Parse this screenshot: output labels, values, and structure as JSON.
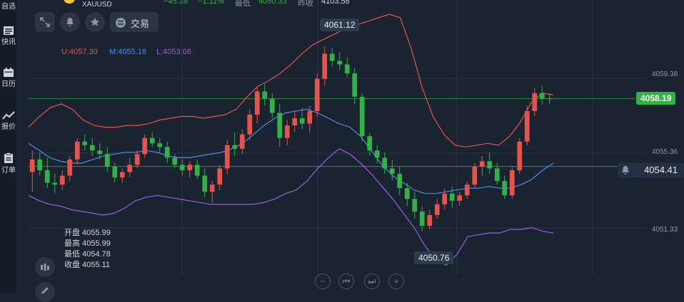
{
  "sidebar": {
    "items": [
      {
        "label": "自选",
        "icon": "star-list-icon"
      },
      {
        "label": "快讯",
        "icon": "newsfeed-icon"
      },
      {
        "label": "日历",
        "icon": "calendar-icon"
      },
      {
        "label": "报价",
        "icon": "quote-chart-icon"
      },
      {
        "label": "订单",
        "icon": "order-clipboard-icon"
      }
    ]
  },
  "header": {
    "symbol": "XAUUSD",
    "change": "−45.39",
    "change_pct": "−1.11%",
    "low_label": "最低",
    "low_value": "4050.33",
    "prev_close_label": "昨收",
    "prev_close_value": "4103.58",
    "trade_label": "交易"
  },
  "bollinger": {
    "upper": "U:4057.30",
    "middle": "M:4055.18",
    "lower": "L:4053.06"
  },
  "ohlc": {
    "open": "开盘 4055.99",
    "high": "最高 4055.99",
    "low": "最低 4054.78",
    "close": "收盘 4055.11"
  },
  "price_tags": {
    "current": "4058.19",
    "alert": "4054.41",
    "high_marker": "4061.12",
    "low_marker": "4050.76"
  },
  "colors": {
    "up": "#e5534b",
    "down": "#2fb344",
    "upper_band": "#e5534b",
    "middle_band": "#4a8cf0",
    "lower_band": "#9b5de5",
    "current_price": "#2fb344"
  },
  "nav": [
    "−",
    "⏮",
    "⏭",
    "+"
  ],
  "chart_data": {
    "type": "candlestick",
    "y_ticks": [
      "4059.38",
      "4055.36",
      "4051.33"
    ],
    "ylim": [
      4048.6,
      4062.9
    ],
    "candles": [
      [
        4054.1,
        4055.3,
        4053.0,
        4054.8
      ],
      [
        4054.8,
        4055.2,
        4053.9,
        4054.2
      ],
      [
        4054.2,
        4054.9,
        4053.2,
        4053.5
      ],
      [
        4053.5,
        4054.0,
        4052.9,
        4053.4
      ],
      [
        4053.4,
        4054.2,
        4053.1,
        4053.9
      ],
      [
        4053.9,
        4055.0,
        4053.6,
        4054.8
      ],
      [
        4054.8,
        4056.0,
        4054.5,
        4055.8
      ],
      [
        4055.8,
        4056.2,
        4055.3,
        4055.6
      ],
      [
        4055.6,
        4056.0,
        4055.0,
        4055.3
      ],
      [
        4055.3,
        4055.7,
        4054.8,
        4055.1
      ],
      [
        4055.1,
        4055.5,
        4054.1,
        4054.4
      ],
      [
        4054.4,
        4054.6,
        4053.5,
        4053.8
      ],
      [
        4053.8,
        4054.3,
        4053.5,
        4054.1
      ],
      [
        4054.1,
        4054.9,
        4053.8,
        4054.5
      ],
      [
        4054.5,
        4055.3,
        4054.3,
        4055.1
      ],
      [
        4055.1,
        4056.2,
        4054.9,
        4056.0
      ],
      [
        4056.0,
        4056.3,
        4055.5,
        4055.7
      ],
      [
        4055.7,
        4056.0,
        4055.2,
        4055.5
      ],
      [
        4055.5,
        4055.8,
        4054.6,
        4054.9
      ],
      [
        4054.9,
        4055.1,
        4054.3,
        4054.5
      ],
      [
        4054.5,
        4054.8,
        4053.9,
        4054.2
      ],
      [
        4054.2,
        4054.7,
        4053.8,
        4054.5
      ],
      [
        4054.5,
        4054.8,
        4053.7,
        4053.9
      ],
      [
        4053.9,
        4054.3,
        4052.7,
        4053.0
      ],
      [
        4053.0,
        4053.6,
        4052.4,
        4053.4
      ],
      [
        4053.4,
        4054.5,
        4053.1,
        4054.3
      ],
      [
        4054.3,
        4055.9,
        4054.0,
        4055.6
      ],
      [
        4055.6,
        4056.3,
        4055.0,
        4055.4
      ],
      [
        4055.4,
        4056.5,
        4055.1,
        4056.2
      ],
      [
        4056.2,
        4057.6,
        4055.9,
        4057.3
      ],
      [
        4057.3,
        4058.9,
        4056.8,
        4058.6
      ],
      [
        4058.6,
        4059.0,
        4057.8,
        4058.2
      ],
      [
        4058.2,
        4058.5,
        4057.1,
        4057.4
      ],
      [
        4057.4,
        4057.9,
        4055.5,
        4056.0
      ],
      [
        4056.0,
        4057.0,
        4055.6,
        4056.7
      ],
      [
        4056.7,
        4057.5,
        4056.3,
        4057.1
      ],
      [
        4057.1,
        4057.7,
        4056.5,
        4056.8
      ],
      [
        4056.8,
        4057.8,
        4056.3,
        4057.5
      ],
      [
        4057.5,
        4059.6,
        4057.2,
        4059.3
      ],
      [
        4059.3,
        4061.1,
        4058.9,
        4060.7
      ],
      [
        4060.7,
        4061.0,
        4060.0,
        4060.3
      ],
      [
        4060.3,
        4060.8,
        4059.8,
        4060.1
      ],
      [
        4060.1,
        4060.5,
        4059.4,
        4059.6
      ],
      [
        4059.6,
        4059.9,
        4057.9,
        4058.3
      ],
      [
        4058.3,
        4058.5,
        4055.8,
        4056.1
      ],
      [
        4056.1,
        4056.3,
        4055.0,
        4055.3
      ],
      [
        4055.3,
        4055.6,
        4054.6,
        4054.9
      ],
      [
        4054.9,
        4055.2,
        4054.0,
        4054.3
      ],
      [
        4054.3,
        4054.8,
        4053.6,
        4054.0
      ],
      [
        4054.0,
        4054.4,
        4052.8,
        4053.2
      ],
      [
        4053.2,
        4053.5,
        4052.2,
        4052.6
      ],
      [
        4052.6,
        4053.0,
        4051.5,
        4051.9
      ],
      [
        4051.9,
        4052.2,
        4050.8,
        4051.1
      ],
      [
        4051.1,
        4052.0,
        4050.9,
        4051.7
      ],
      [
        4051.7,
        4052.6,
        4051.5,
        4052.3
      ],
      [
        4052.3,
        4053.2,
        4052.0,
        4052.9
      ],
      [
        4052.9,
        4053.3,
        4052.1,
        4052.5
      ],
      [
        4052.5,
        4053.0,
        4052.2,
        4052.8
      ],
      [
        4052.8,
        4053.6,
        4052.6,
        4053.4
      ],
      [
        4053.4,
        4054.6,
        4053.2,
        4054.4
      ],
      [
        4054.4,
        4055.0,
        4053.9,
        4054.7
      ],
      [
        4054.7,
        4055.2,
        4054.0,
        4054.3
      ],
      [
        4054.3,
        4054.6,
        4053.4,
        4053.6
      ],
      [
        4053.6,
        4053.9,
        4052.6,
        4052.8
      ],
      [
        4052.8,
        4054.4,
        4052.6,
        4054.2
      ],
      [
        4054.2,
        4056.0,
        4054.0,
        4055.8
      ],
      [
        4055.8,
        4057.8,
        4055.6,
        4057.5
      ],
      [
        4057.5,
        4058.8,
        4057.2,
        4058.5
      ],
      [
        4058.5,
        4058.9,
        4057.9,
        4058.2
      ],
      [
        4058.2,
        4058.5,
        4057.9,
        4058.19
      ]
    ],
    "upper_band": [
      4056.6,
      4057.2,
      4057.7,
      4057.9,
      4057.6,
      4057.0,
      4056.7,
      4056.6,
      4056.6,
      4056.7,
      4056.7,
      4056.8,
      4057.0,
      4057.1,
      4057.2,
      4057.2,
      4057.1,
      4057.2,
      4057.3,
      4057.6,
      4058.3,
      4058.9,
      4059.2,
      4059.6,
      4060.1,
      4060.7,
      4061.2,
      4061.5,
      4061.8,
      4062.1,
      4062.3,
      4062.5,
      4062.7,
      4062.9,
      4062.7,
      4061.0,
      4058.8,
      4057.2,
      4056.2,
      4055.6,
      4055.5,
      4055.6,
      4055.7,
      4055.6,
      4056.1,
      4056.9,
      4058.0,
      4058.5,
      4058.4
    ],
    "middle_band": [
      4055.7,
      4055.3,
      4054.9,
      4054.7,
      4054.6,
      4054.6,
      4054.8,
      4055.0,
      4055.1,
      4055.2,
      4055.2,
      4055.3,
      4055.2,
      4055.0,
      4054.9,
      4054.9,
      4055.0,
      4055.1,
      4055.2,
      4055.4,
      4055.7,
      4056.2,
      4056.7,
      4057.1,
      4057.4,
      4057.5,
      4057.6,
      4057.4,
      4057.1,
      4056.8,
      4056.6,
      4056.1,
      4055.3,
      4054.5,
      4053.9,
      4053.5,
      4053.1,
      4052.9,
      4052.9,
      4053.0,
      4053.1,
      4053.2,
      4053.2,
      4053.3,
      4053.2,
      4053.2,
      4053.4,
      4053.7,
      4054.2,
      4054.6
    ],
    "lower_band": [
      4052.8,
      4052.5,
      4052.3,
      4052.2,
      4052.0,
      4051.9,
      4051.8,
      4051.7,
      4051.8,
      4052.1,
      4052.5,
      4052.7,
      4052.8,
      4052.7,
      4052.6,
      4052.5,
      4052.4,
      4052.3,
      4052.3,
      4052.3,
      4052.3,
      4052.3,
      4052.4,
      4052.6,
      4052.9,
      4053.1,
      4053.6,
      4054.3,
      4054.9,
      4055.4,
      4055.1,
      4054.6,
      4054.0,
      4053.3,
      4052.6,
      4051.8,
      4051.0,
      4050.0,
      4049.2,
      4048.9,
      4049.5,
      4050.5,
      4050.6,
      4050.7,
      4050.7,
      4050.9,
      4050.9,
      4051.0,
      4050.8,
      4050.7
    ]
  }
}
